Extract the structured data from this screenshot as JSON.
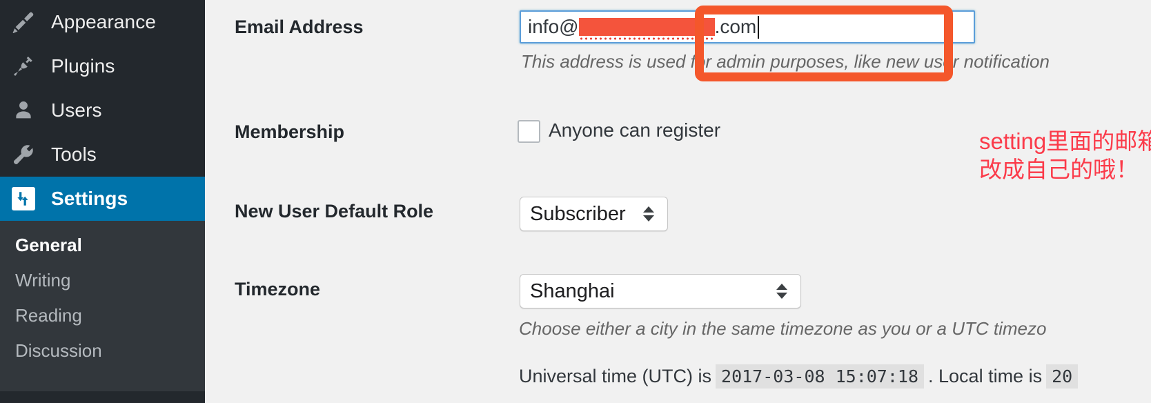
{
  "sidebar": {
    "items": [
      {
        "label": "Appearance",
        "icon": "paintbrush-icon",
        "active": false
      },
      {
        "label": "Plugins",
        "icon": "plug-icon",
        "active": false
      },
      {
        "label": "Users",
        "icon": "user-icon",
        "active": false
      },
      {
        "label": "Tools",
        "icon": "wrench-icon",
        "active": false
      },
      {
        "label": "Settings",
        "icon": "settings-sliders-icon",
        "active": true
      }
    ],
    "submenu": [
      {
        "label": "General",
        "current": true
      },
      {
        "label": "Writing",
        "current": false
      },
      {
        "label": "Reading",
        "current": false
      },
      {
        "label": "Discussion",
        "current": false
      }
    ],
    "colors": {
      "background": "#23282d",
      "submenu_background": "#32373c",
      "active_background": "#0073aa",
      "label": "#eeeeee",
      "submenu_label": "#b4b9be"
    }
  },
  "form": {
    "email": {
      "label": "Email Address",
      "value_prefix": "info@",
      "value_suffix": ".com",
      "redacted": true,
      "description": "This address is used for admin purposes, like new user notification",
      "focused": true
    },
    "membership": {
      "label": "Membership",
      "checkbox_label": "Anyone can register",
      "checked": false
    },
    "new_user_role": {
      "label": "New User Default Role",
      "value": "Subscriber"
    },
    "timezone": {
      "label": "Timezone",
      "value": "Shanghai",
      "description": "Choose either a city in the same timezone as you or a UTC timezo"
    },
    "time_info": {
      "utc_prefix": "Universal time (UTC) is",
      "utc_value": "2017-03-08 15:07:18",
      "separator": ". Local time is",
      "local_value": "20"
    }
  },
  "annotation": {
    "text": "setting里面的邮箱也别忘了\n改成自己的哦！",
    "color": "#fb3b4a"
  },
  "highlight": {
    "color": "#f4572b",
    "target": "email-address-field"
  }
}
